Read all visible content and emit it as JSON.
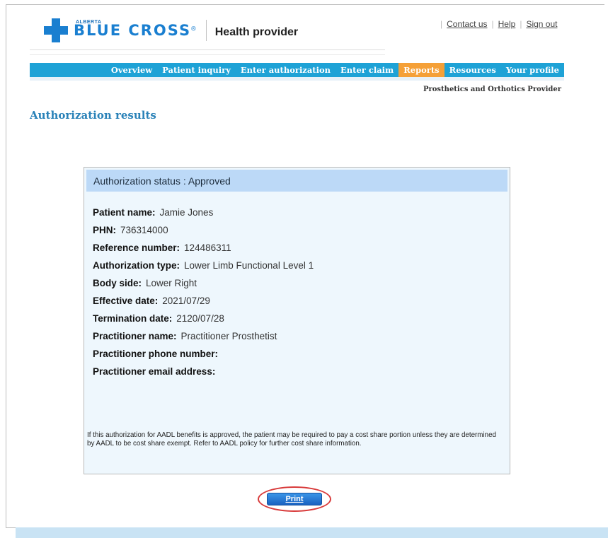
{
  "header": {
    "brand_small": "ALBERTA",
    "brand_big": "BLUE CROSS",
    "brand_reg": "®",
    "product": "Health provider",
    "links": [
      {
        "label": "Contact us"
      },
      {
        "label": "Help"
      },
      {
        "label": "Sign out"
      }
    ]
  },
  "nav": {
    "items": [
      {
        "label": "Overview",
        "active": false
      },
      {
        "label": "Patient inquiry",
        "active": false
      },
      {
        "label": "Enter authorization",
        "active": false
      },
      {
        "label": "Enter claim",
        "active": false
      },
      {
        "label": "Reports",
        "active": true
      },
      {
        "label": "Resources",
        "active": false
      },
      {
        "label": "Your profile",
        "active": false
      }
    ],
    "subtitle": "Prosthetics and Orthotics Provider"
  },
  "page": {
    "title": "Authorization results"
  },
  "result": {
    "status_heading": "Authorization status : Approved",
    "fields": [
      {
        "label": "Patient name:",
        "value": "Jamie Jones"
      },
      {
        "label": "PHN:",
        "value": "736314000"
      },
      {
        "label": "Reference number:",
        "value": "124486311"
      },
      {
        "label": "Authorization type:",
        "value": "Lower Limb Functional Level 1"
      },
      {
        "label": "Body side:",
        "value": "Lower Right"
      },
      {
        "label": "Effective date:",
        "value": "2021/07/29"
      },
      {
        "label": "Termination date:",
        "value": "2120/07/28"
      },
      {
        "label": "Practitioner name:",
        "value": "Practitioner Prosthetist"
      },
      {
        "label": "Practitioner phone number:",
        "value": ""
      },
      {
        "label": "Practitioner email address:",
        "value": ""
      }
    ],
    "note": "If this authorization for AADL benefits is approved, the patient may be required to pay a cost share portion unless they are determined by AADL to be cost share exempt. Refer to AADL policy for further cost share information."
  },
  "actions": {
    "print_label": "Print"
  },
  "colors": {
    "brand_blue": "#1a7fd0",
    "nav_blue": "#1ea2d6",
    "nav_active": "#f5a037",
    "highlight_ring": "#d83a3a"
  }
}
